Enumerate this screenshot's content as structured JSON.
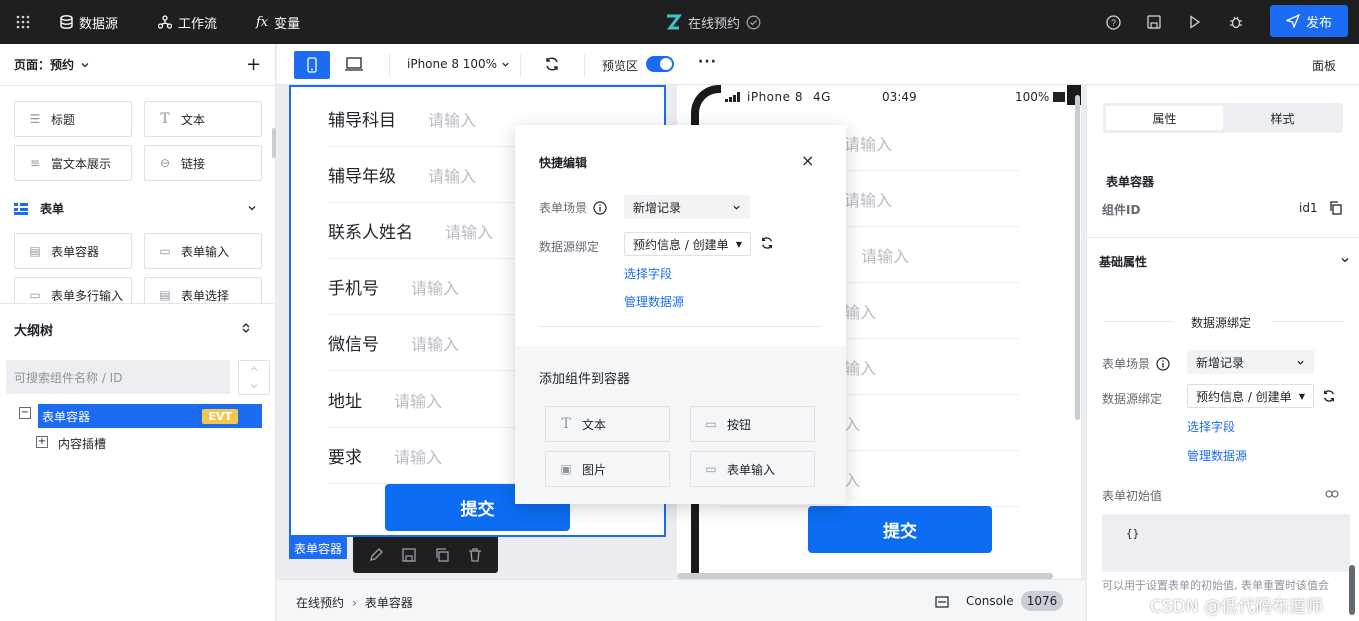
{
  "topbar": {
    "datasource": "数据源",
    "workflow": "工作流",
    "variables": "变量",
    "fx_prefix": "fx",
    "app_title": "在线预约",
    "publish": "发布"
  },
  "left": {
    "page_label": "页面：预约",
    "components": [
      {
        "icon": "heading-icon",
        "label": "标题"
      },
      {
        "icon": "text-icon",
        "label": "文本"
      },
      {
        "icon": "richtext-icon",
        "label": "富文本展示"
      },
      {
        "icon": "link-icon",
        "label": "链接"
      }
    ],
    "form_group": "表单",
    "form_components": [
      {
        "icon": "form-container-icon",
        "label": "表单容器"
      },
      {
        "icon": "form-input-icon",
        "label": "表单输入"
      },
      {
        "icon": "form-textarea-icon",
        "label": "表单多行输入"
      },
      {
        "icon": "form-select-icon",
        "label": "表单选择"
      }
    ],
    "outline_title": "大纲树",
    "search_placeholder": "可搜索组件名称 / ID",
    "tree": {
      "root": "表单容器",
      "badge": "EVT",
      "child": "内容插槽"
    }
  },
  "toolbar": {
    "device": "iPhone 8 100%",
    "preview": "预览区",
    "more": "···",
    "panel": "面板"
  },
  "form": {
    "fields": [
      {
        "label": "辅导科目",
        "placeholder": "请输入"
      },
      {
        "label": "辅导年级",
        "placeholder": "请输入"
      },
      {
        "label": "联系人姓名",
        "placeholder": "请输入"
      },
      {
        "label": "手机号",
        "placeholder": "请输入"
      },
      {
        "label": "微信号",
        "placeholder": "请输入"
      },
      {
        "label": "地址",
        "placeholder": "请输入"
      },
      {
        "label": "要求",
        "placeholder": "请输入"
      }
    ],
    "submit": "提交",
    "tag": "表单容器"
  },
  "phone": {
    "carrier": "iPhone 8",
    "network": "4G",
    "time": "03:49",
    "battery": "100%",
    "placeholders": [
      "请输入",
      "请输入",
      "请输入",
      "输入",
      "输入",
      "入",
      "入"
    ],
    "submit": "提交"
  },
  "popup": {
    "title": "快捷编辑",
    "scene_label": "表单场景",
    "scene_value": "新增记录",
    "ds_label": "数据源绑定",
    "ds_value": "预约信息 / 创建单",
    "select_field": "选择字段",
    "manage_ds": "管理数据源",
    "add_title": "添加组件到容器",
    "add_items": [
      {
        "icon": "text-icon",
        "label": "文本"
      },
      {
        "icon": "button-icon",
        "label": "按钮"
      },
      {
        "icon": "image-icon",
        "label": "图片"
      },
      {
        "icon": "form-input-icon",
        "label": "表单输入"
      }
    ]
  },
  "right": {
    "tab_props": "属性",
    "tab_style": "样式",
    "component_name": "表单容器",
    "id_label": "组件ID",
    "id_value": "id1",
    "basic_props": "基础属性",
    "ds_section": "数据源绑定",
    "scene_label": "表单场景",
    "scene_value": "新增记录",
    "ds_label": "数据源绑定",
    "ds_value": "预约信息 / 创建单",
    "select_field": "选择字段",
    "manage_ds": "管理数据源",
    "init_label": "表单初始值",
    "init_value": "{}",
    "hint": "可以用于设置表单的初始值, 表单重置时该值会"
  },
  "status": {
    "crumb1": "在线预约",
    "crumb2": "表单容器",
    "console": "Console",
    "count": "1076",
    "watermark": "CSDN @低代码布道师"
  },
  "colors": {
    "primary": "#1b6cf2",
    "topbar": "#1f1f1f"
  }
}
